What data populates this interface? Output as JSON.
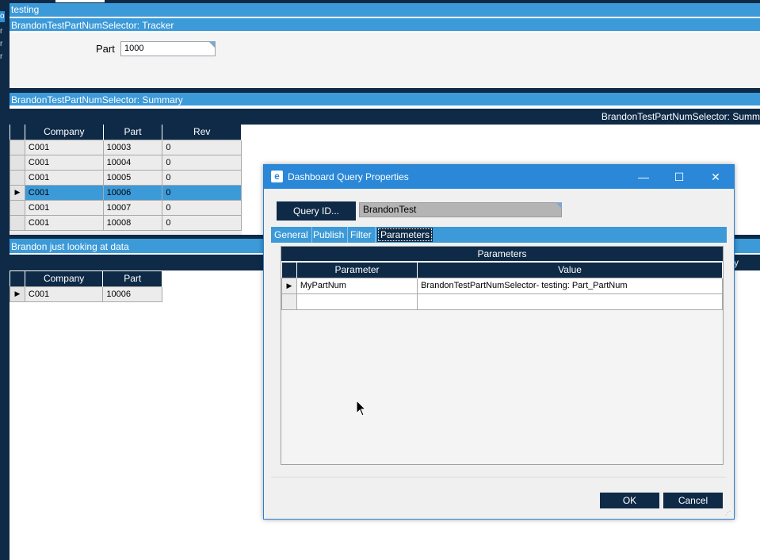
{
  "left_strip": {
    "selected_char": "o",
    "ticks": [
      "r",
      "r",
      "r"
    ]
  },
  "top_panel": {
    "title": "testing"
  },
  "tracker": {
    "title": "BrandonTestPartNumSelector: Tracker",
    "part_label": "Part",
    "part_value": "1000"
  },
  "summary": {
    "title": "BrandonTestPartNumSelector: Summary",
    "subtitle": "BrandonTestPartNumSelector: Summ",
    "columns": [
      "Company",
      "Part",
      "Rev"
    ],
    "rows": [
      [
        "C001",
        "10003",
        "0"
      ],
      [
        "C001",
        "10004",
        "0"
      ],
      [
        "C001",
        "10005",
        "0"
      ],
      [
        "C001",
        "10006",
        "0"
      ],
      [
        "C001",
        "10007",
        "0"
      ],
      [
        "C001",
        "10008",
        "0"
      ]
    ],
    "selected_row_index": 3
  },
  "brandon_panel": {
    "title": "Brandon just looking at data",
    "sub_right": "y",
    "columns": [
      "Company",
      "Part"
    ],
    "rows": [
      [
        "C001",
        "10006"
      ]
    ]
  },
  "dialog": {
    "title": "Dashboard Query Properties",
    "logo": "e",
    "minimize": "—",
    "maximize": "☐",
    "close": "✕",
    "query_id_button": "Query ID...",
    "query_id_value": "BrandonTest",
    "tabs": [
      "General",
      "Publish",
      "Filter",
      "Parameters"
    ],
    "active_tab": "Parameters",
    "params_title": "Parameters",
    "params_columns": [
      "Parameter",
      "Value"
    ],
    "params_rows": [
      [
        "MyPartNum",
        "BrandonTestPartNumSelector- testing: Part_PartNum"
      ]
    ],
    "ok": "OK",
    "cancel": "Cancel"
  },
  "colors": {
    "navy": "#0e2a47",
    "accent": "#3c9ad8",
    "selection": "#3c9ad8"
  }
}
